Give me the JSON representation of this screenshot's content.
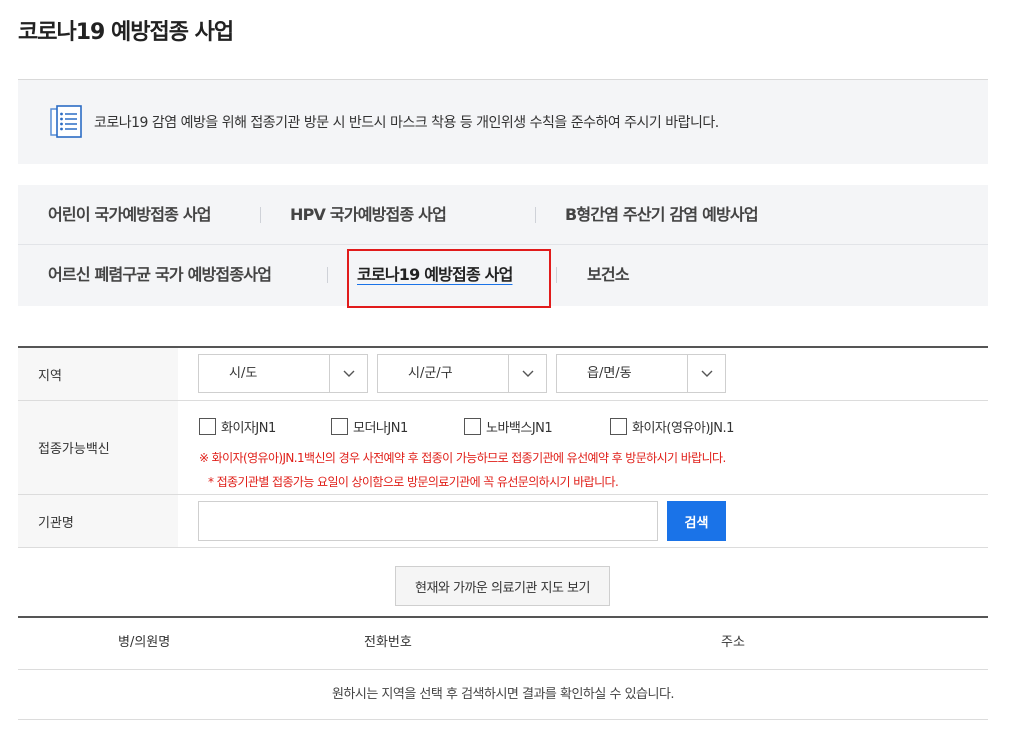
{
  "page": {
    "title": "코로나19 예방접종 사업"
  },
  "notice": {
    "icon": "document-list-icon",
    "text": "코로나19 감염 예방을 위해 접종기관 방문 시 반드시 마스크 착용 등 개인위생 수칙을 준수하여 주시기 바랍니다."
  },
  "tabs": {
    "row1": [
      "어린이 국가예방접종 사업",
      "HPV 국가예방접종 사업",
      "B형간염 주산기 감염 예방사업"
    ],
    "row2": [
      "어르신 폐렴구균 국가 예방접종사업",
      "코로나19 예방접종 사업",
      "보건소"
    ],
    "active": "코로나19 예방접종 사업",
    "accent_color": "#1a73e8",
    "highlight_color": "#e11b1b"
  },
  "form": {
    "region": {
      "label": "지역",
      "selects": [
        "시/도",
        "시/군/구",
        "읍/면/동"
      ]
    },
    "vaccine": {
      "label": "접종가능백신",
      "options": [
        "화이자JN1",
        "모더나JN1",
        "노바백스JN1",
        "화이자(영유아)JN.1"
      ],
      "warning1": "※ 화이자(영유아)JN.1백신의 경우 사전예약 후 접종이 가능하므로 접종기관에 유선예약 후 방문하시기 바랍니다.",
      "warning2": "* 접종기관별 접종가능 요일이 상이함으로 방문의료기관에 꼭 유선문의하시기 바랍니다.",
      "warning_color": "#e0201a"
    },
    "institution": {
      "label": "기관명",
      "value": "",
      "search_label": "검색"
    }
  },
  "map_button": "현재와 가까운 의료기관 지도 보기",
  "results": {
    "columns": [
      "병/의원명",
      "전화번호",
      "주소"
    ],
    "empty_message": "원하시는 지역을 선택 후 검색하시면 결과를 확인하실 수 있습니다."
  }
}
